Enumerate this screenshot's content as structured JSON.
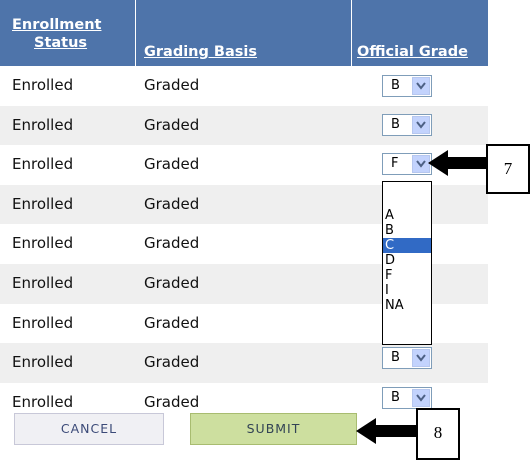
{
  "table": {
    "headers": {
      "enrollment_status_line1": "Enrollment",
      "enrollment_status_line2": "Status",
      "grading_basis": "Grading Basis",
      "official_grade": "Official Grade"
    },
    "rows": [
      {
        "status": "Enrolled",
        "basis": "Graded",
        "grade": "B"
      },
      {
        "status": "Enrolled",
        "basis": "Graded",
        "grade": "B"
      },
      {
        "status": "Enrolled",
        "basis": "Graded",
        "grade": "F"
      },
      {
        "status": "Enrolled",
        "basis": "Graded",
        "grade": ""
      },
      {
        "status": "Enrolled",
        "basis": "Graded",
        "grade": ""
      },
      {
        "status": "Enrolled",
        "basis": "Graded",
        "grade": ""
      },
      {
        "status": "Enrolled",
        "basis": "Graded",
        "grade": ""
      },
      {
        "status": "Enrolled",
        "basis": "Graded",
        "grade": "B"
      },
      {
        "status": "Enrolled",
        "basis": "Graded",
        "grade": "B"
      }
    ]
  },
  "dropdown": {
    "options": [
      "",
      "A",
      "B",
      "C",
      "D",
      "F",
      "I",
      "NA"
    ],
    "highlighted": "C"
  },
  "buttons": {
    "cancel": "CANCEL",
    "submit": "SUBMIT"
  },
  "callouts": {
    "step7": "7",
    "step8": "8"
  },
  "colors": {
    "header_bg": "#4e74aa",
    "row_alt_bg": "#efefef",
    "highlight": "#316ac5",
    "submit_bg": "#cddf9f",
    "cancel_bg": "#f0f0f4"
  }
}
